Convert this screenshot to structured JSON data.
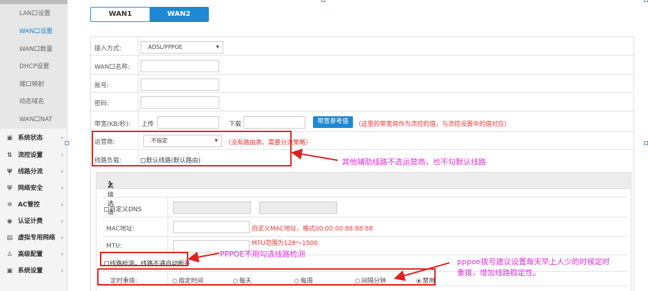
{
  "sidebar": {
    "sub_items": [
      {
        "label": "LAN口设置"
      },
      {
        "label": "WAN口设置"
      },
      {
        "label": "WAN口数量"
      },
      {
        "label": "DHCP设置"
      },
      {
        "label": "端口映射"
      },
      {
        "label": "动态域名"
      },
      {
        "label": "WAN口NAT"
      }
    ],
    "main_items": [
      {
        "label": "系统状态",
        "icon": "monitor-icon"
      },
      {
        "label": "流控设置",
        "icon": "flow-icon"
      },
      {
        "label": "线路分流",
        "icon": "fork-icon"
      },
      {
        "label": "网络安全",
        "icon": "shield-icon"
      },
      {
        "label": "AC管控",
        "icon": "ac-icon"
      },
      {
        "label": "认证计费",
        "icon": "auth-icon"
      },
      {
        "label": "虚拟专用网络",
        "icon": "vpn-icon"
      },
      {
        "label": "高级配置",
        "icon": "advanced-icon"
      },
      {
        "label": "系统设置",
        "icon": "settings-icon"
      }
    ],
    "arrow": "›"
  },
  "tabs": [
    "WAN1",
    "WAN2"
  ],
  "form": {
    "access_mode_label": "接入方式:",
    "access_mode_value": "ADSL/PPPOE",
    "wan_name_label": "WAN口名称:",
    "account_label": "账号:",
    "password_label": "密码:",
    "bandwidth_label": "带宽(KB/秒):",
    "upload_label": "上传",
    "download_label": "下载",
    "bandwidth_ref_button": "带宽参考值",
    "bandwidth_note": "（这里的带宽将作为流控的值，与流控设置中的值对应）",
    "isp_label": "运营商:",
    "isp_value": "不指定",
    "isp_note": "（没有路由表，需要分流策略）",
    "line_load_label": "线路负载:",
    "default_line_label": "默认线路(默认路由)"
  },
  "advanced": {
    "title": "高级选项",
    "custom_dns_label": "自定义DNS",
    "mac_label": "MAC地址:",
    "mac_note": "自定义MAC地址，格式00:00:00:88:88:88",
    "mtu_label": "MTU:",
    "mtu_note": "MTU范围为128～1500",
    "line_detect_label": "线路检测，线路不通自动断开",
    "redial_label": "定时重拨:",
    "redial_options": [
      "指定时间",
      "每天",
      "每周",
      "间隔分钟",
      "禁用"
    ]
  },
  "annotations": {
    "note1": "其他辅助线路不选运营商，也不勾默认线路",
    "note2": "PPPOE不用勾选线路检测",
    "note3_line1": "pppoe拨号建议设置每天早上人少的时候定时",
    "note3_line2": "重拨，增加线路稳定性。"
  },
  "colors": {
    "accent": "#1e88d4",
    "annotation_red": "#e0211f",
    "annotation_text": "#e030e0",
    "note_red": "#e33"
  }
}
